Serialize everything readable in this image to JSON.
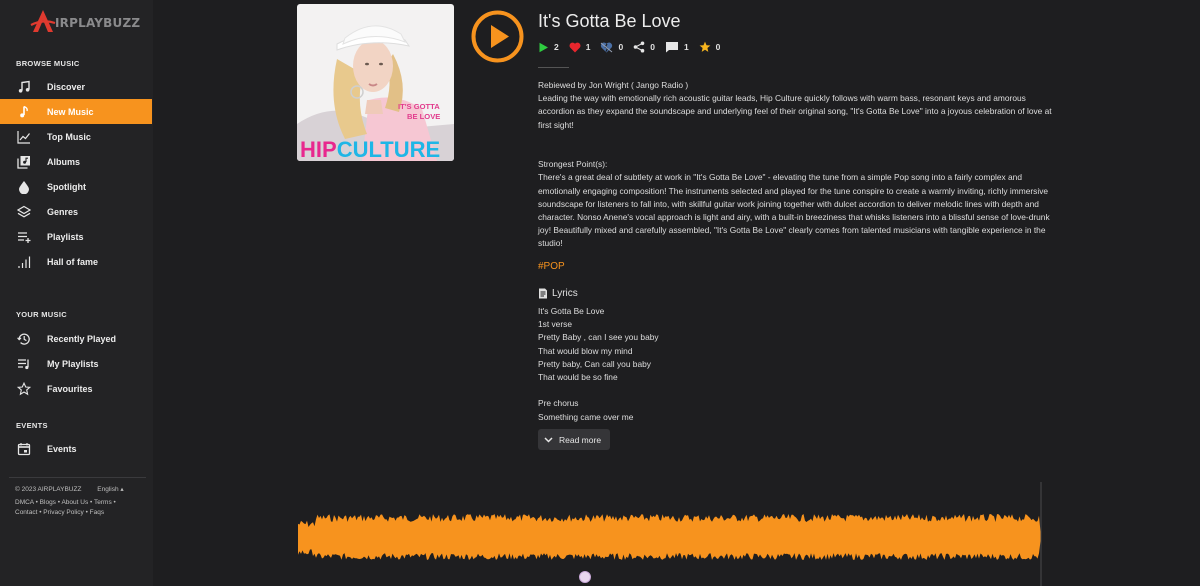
{
  "brand": {
    "name": "IRPLAYBUZZ"
  },
  "colors": {
    "accent": "#f7931e",
    "background": "#1e1e20",
    "sidebar": "#232325"
  },
  "sidebar": {
    "browse_title": "BROWSE MUSIC",
    "browse_items": [
      {
        "label": "Discover",
        "icon": "music-note-icon"
      },
      {
        "label": "New Music",
        "icon": "music-note-single-icon",
        "active": true
      },
      {
        "label": "Top Music",
        "icon": "trending-chart-icon"
      },
      {
        "label": "Albums",
        "icon": "album-library-icon"
      },
      {
        "label": "Spotlight",
        "icon": "droplet-icon"
      },
      {
        "label": "Genres",
        "icon": "layers-icon"
      },
      {
        "label": "Playlists",
        "icon": "playlist-add-icon"
      },
      {
        "label": "Hall of fame",
        "icon": "bars-chart-icon"
      }
    ],
    "your_title": "YOUR MUSIC",
    "your_items": [
      {
        "label": "Recently Played",
        "icon": "history-icon"
      },
      {
        "label": "My Playlists",
        "icon": "playlist-icon"
      },
      {
        "label": "Favourites",
        "icon": "star-outline-icon"
      }
    ],
    "events_title": "EVENTS",
    "events_items": [
      {
        "label": "Events",
        "icon": "calendar-icon"
      }
    ],
    "footer": {
      "copyright": "© 2023 AIRPLAYBUZZ",
      "language": "English",
      "links": [
        "DMCA",
        "Blogs",
        "About Us",
        "Terms",
        "Contact",
        "Privacy Policy",
        "Faqs"
      ]
    }
  },
  "song": {
    "title": "It's Gotta Be Love",
    "cover_text_line1": "IT'S GOTTA",
    "cover_text_line2": "BE LOVE",
    "cover_artist_part1": "HIP",
    "cover_artist_part2": "CULTURE",
    "stats": {
      "plays": "2",
      "likes": "1",
      "dislikes": "0",
      "shares": "0",
      "comments": "1",
      "stars": "0"
    }
  },
  "review": {
    "byline": "Rebiewed by Jon Wright ( Jango Radio )",
    "intro": "Leading the way with emotionally rich acoustic guitar leads, Hip Culture quickly follows with warm bass, resonant keys and amorous accordion as they expand the soundscape and underlying feel of their original song, \"It's Gotta Be Love\" into a joyous celebration of love at first sight!",
    "strong_title": "Strongest Point(s):",
    "strong_text": "There's a great deal of subtlety at work in \"It's Gotta Be Love\" - elevating the tune from a simple Pop song into a fairly complex and emotionally engaging composition! The instruments selected and played for the tune conspire to create a warmly inviting, richly immersive soundscape for listeners to fall into, with skillful guitar work joining together with dulcet accordion to deliver melodic lines with depth and character. Nonso Anene's vocal approach is light and airy, with a built-in breeziness that whisks listeners into a blissful sense of love-drunk joy! Beautifully mixed and carefully assembled, \"It's Gotta Be Love\" clearly comes from talented musicians with tangible experience in the studio!"
  },
  "hashtag": "#POP",
  "lyrics": {
    "title": "Lyrics",
    "lines": [
      "It's Gotta Be Love",
      "1st verse",
      "Pretty Baby , can I see you baby",
      "That would blow my mind",
      "Pretty baby, Can call you baby",
      "That would be so fine",
      "",
      "Pre chorus",
      "Something came over me"
    ],
    "read_more": "Read more"
  }
}
